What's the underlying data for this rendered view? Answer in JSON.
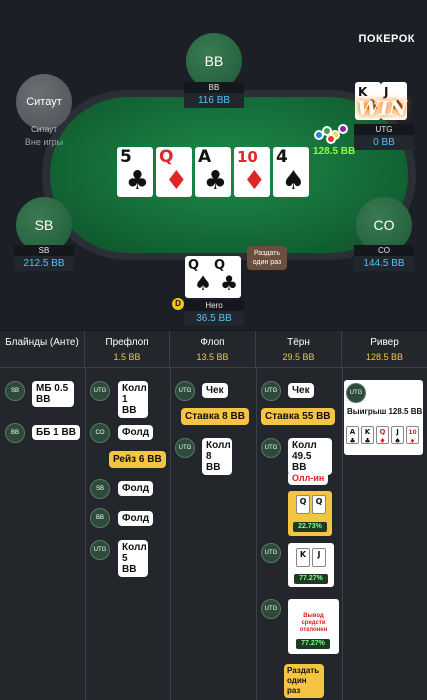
{
  "logo": "ПОКЕРОК",
  "seats": {
    "bb": {
      "label": "BB",
      "name": "BB",
      "stack": "116 BB"
    },
    "sitout": {
      "label": "Ситаут",
      "name": "Ситаут",
      "status": "Вне игры"
    },
    "utg": {
      "name": "UTG",
      "stack": "0 BB",
      "win_label": "WIN"
    },
    "sb": {
      "label": "SB",
      "name": "SB",
      "stack": "212.5 BB"
    },
    "co": {
      "label": "CO",
      "name": "CO",
      "stack": "144.5 BB"
    },
    "hero": {
      "name": "Hero",
      "stack": "36.5 BB"
    }
  },
  "pot": "128.5 BB",
  "board": [
    {
      "rank": "5",
      "suit": "♣",
      "red": false
    },
    {
      "rank": "Q",
      "suit": "♦",
      "red": true
    },
    {
      "rank": "A",
      "suit": "♣",
      "red": false
    },
    {
      "rank": "10",
      "suit": "♦",
      "red": true
    },
    {
      "rank": "4",
      "suit": "♠",
      "red": false
    }
  ],
  "hero_cards": [
    {
      "rank": "Q",
      "suit": "♠"
    },
    {
      "rank": "Q",
      "suit": "♣"
    }
  ],
  "winner_cards": [
    {
      "rank": "K",
      "suit": "♣"
    },
    {
      "rank": "J",
      "suit": "♠"
    }
  ],
  "deal_once_bubble": "Раздать один раз",
  "dealer_button": "D",
  "streets": [
    {
      "name": "Блайнды (Анте)",
      "pot": ""
    },
    {
      "name": "Префлоп",
      "pot": "1.5 BB"
    },
    {
      "name": "Флоп",
      "pot": "13.5 BB"
    },
    {
      "name": "Тёрн",
      "pot": "29.5 BB"
    },
    {
      "name": "Ривер",
      "pot": "128.5 BB"
    }
  ],
  "history": {
    "blinds": [
      {
        "pos": "SB",
        "text": "МБ 0.5 BB"
      },
      {
        "pos": "BB",
        "text": "ББ 1 BB"
      }
    ],
    "preflop": [
      {
        "pos": "UTG",
        "text": "Колл 1 BB"
      },
      {
        "pos": "CO",
        "text": "Фолд"
      },
      {
        "raise": "Рейз 6 BB"
      },
      {
        "pos": "SB",
        "text": "Фолд"
      },
      {
        "pos": "BB",
        "text": "Фолд"
      },
      {
        "pos": "UTG",
        "text": "Колл 5 BB"
      }
    ],
    "flop": [
      {
        "pos": "UTG",
        "text": "Чек"
      },
      {
        "bet": "Ставка 8 BB"
      },
      {
        "pos": "UTG",
        "text": "Колл 8 BB"
      }
    ],
    "turn": [
      {
        "pos": "UTG",
        "text": "Чек"
      },
      {
        "bet": "Ставка 55 BB"
      },
      {
        "pos": "UTG",
        "text": "Колл 49.5 BB"
      },
      {
        "allin": "Олл-ин"
      },
      {
        "hero_equity": "22.73%",
        "cards": [
          "Q",
          "Q"
        ]
      },
      {
        "pos": "UTG",
        "equity": "77.27%",
        "cards": [
          "K",
          "J"
        ]
      },
      {
        "pos": "UTG",
        "withdraw": "Вывод средств отклонен",
        "equity": "77.27%"
      },
      {
        "deal_once": "Раздать один раз"
      }
    ],
    "river": {
      "pos": "UTG",
      "win_text": "Выигрыш 128.5 BB",
      "cards": [
        {
          "rank": "A",
          "suit": "♣",
          "red": false
        },
        {
          "rank": "K",
          "suit": "♣",
          "red": false
        },
        {
          "rank": "Q",
          "suit": "♦",
          "red": true
        },
        {
          "rank": "J",
          "suit": "♠",
          "red": false
        },
        {
          "rank": "10",
          "suit": "♦",
          "red": true
        }
      ]
    }
  },
  "colors": {
    "felt": "#146c38",
    "accent_yellow": "#f4c542",
    "stack_blue": "#4fc3f7",
    "pot_green": "#8bff3a",
    "red": "#d8231d"
  }
}
